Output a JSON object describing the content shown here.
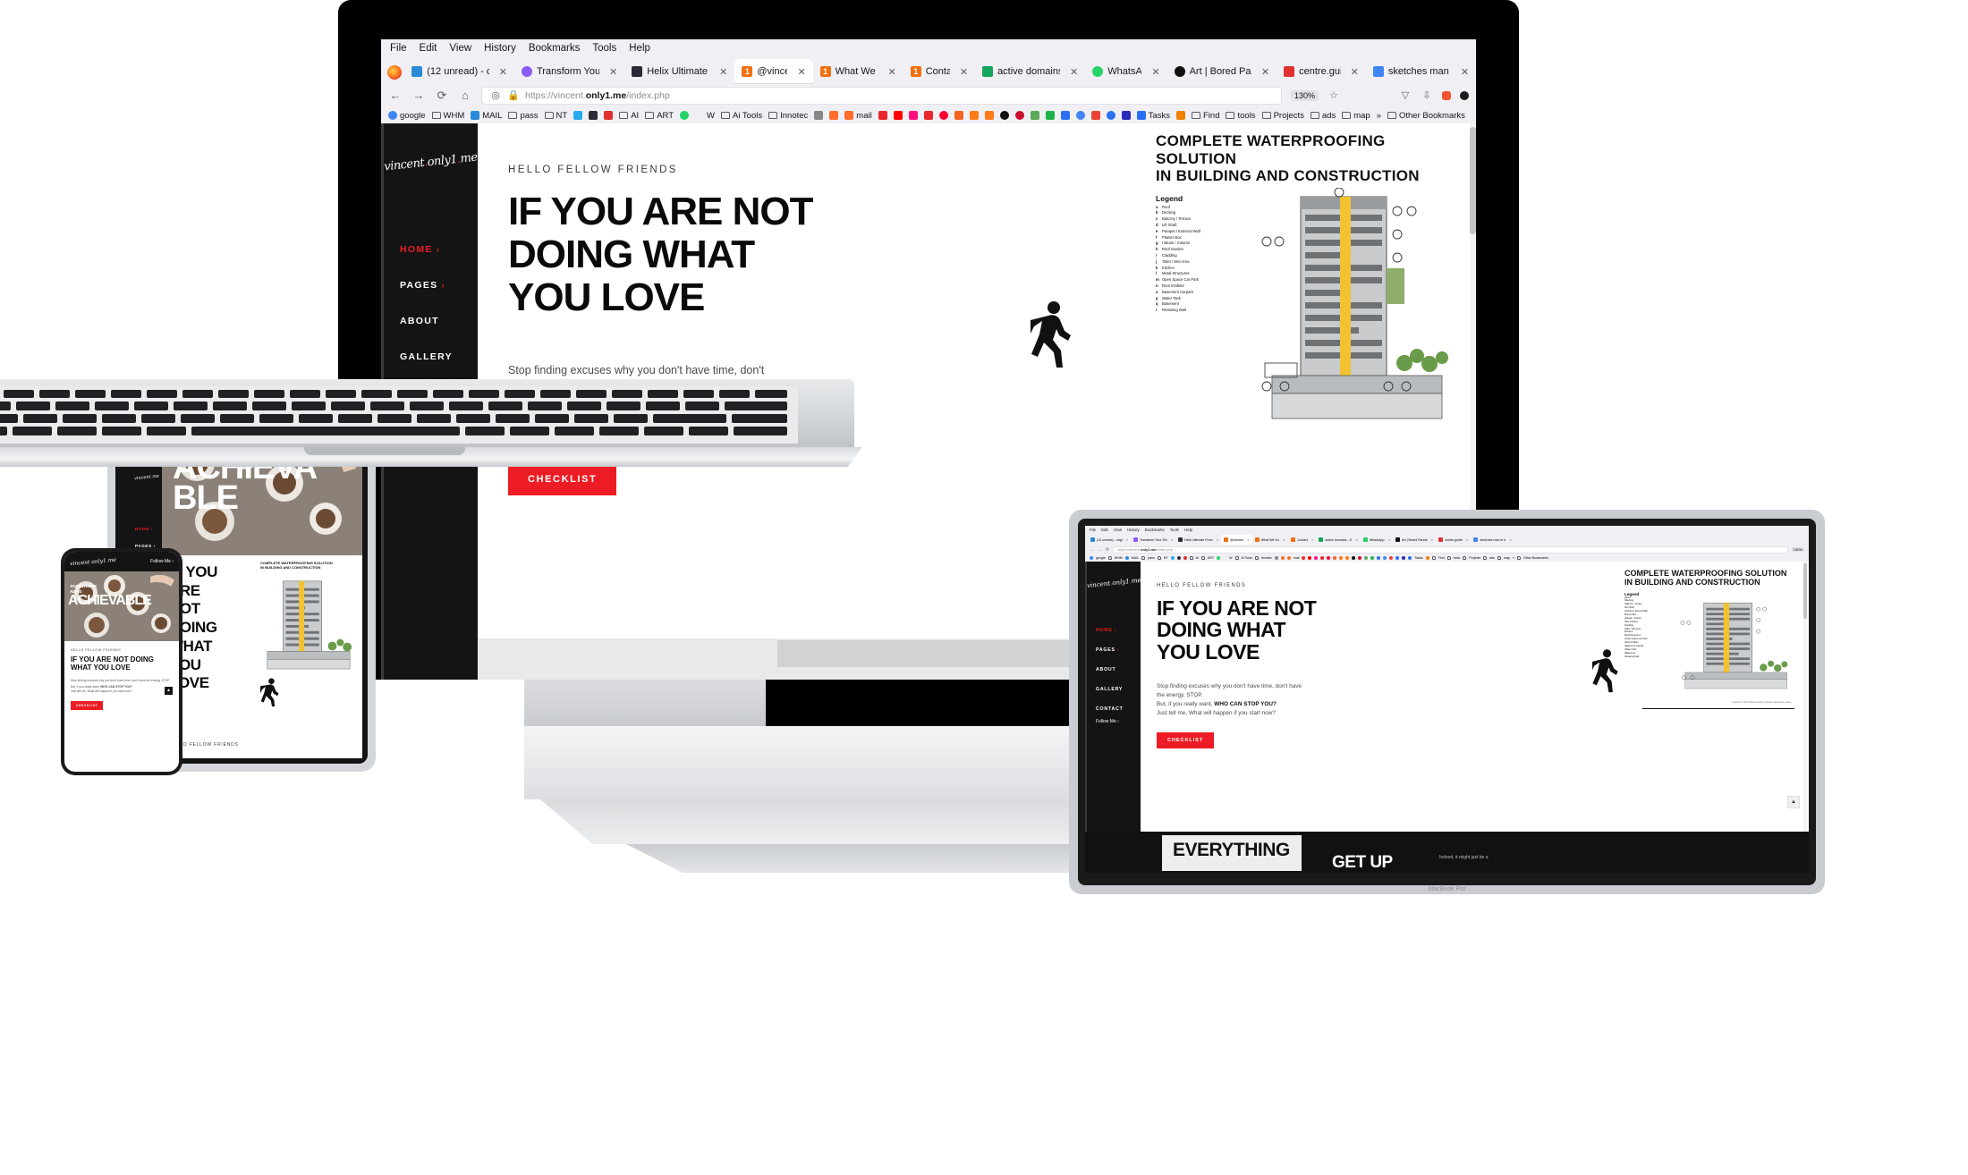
{
  "browser": {
    "menu": [
      "File",
      "Edit",
      "View",
      "History",
      "Bookmarks",
      "Tools",
      "Help"
    ],
    "tabs": [
      {
        "label": "(12 unread) - origi",
        "icon": "mail-icon",
        "active": false
      },
      {
        "label": "Transform Your Ski",
        "icon": "purple-circle-icon",
        "active": false
      },
      {
        "label": "Helix Ultimate Fram",
        "icon": "joomla-icon",
        "active": false
      },
      {
        "label": "@vincent",
        "icon": "orange-one-icon",
        "active": true
      },
      {
        "label": "What We Do",
        "icon": "orange-one-icon",
        "active": false
      },
      {
        "label": "Contact",
        "icon": "orange-one-icon",
        "active": false
      },
      {
        "label": "active domains - G",
        "icon": "sheets-icon",
        "active": false
      },
      {
        "label": "WhatsApp",
        "icon": "whatsapp-icon",
        "active": false
      },
      {
        "label": "Art | Bored Panda",
        "icon": "boredpanda-icon",
        "active": false
      },
      {
        "label": "centre.guide",
        "icon": "red-square-icon",
        "active": false
      },
      {
        "label": "sketches man in b",
        "icon": "google-icon",
        "active": false
      }
    ],
    "url_prefix": "https://vincent.",
    "url_bold": "only1.me",
    "url_suffix": "/index.php",
    "zoom": "130%",
    "bookmarks": [
      {
        "label": "google",
        "icon": "google-icon"
      },
      {
        "label": "WHM",
        "icon": "folder-icon"
      },
      {
        "label": "MAIL",
        "icon": "mail-icon"
      },
      {
        "label": "pass",
        "icon": "folder-icon"
      },
      {
        "label": "NT",
        "icon": "folder-icon"
      },
      {
        "label": "",
        "icon": "telegram-icon"
      },
      {
        "label": "",
        "icon": "joomla-icon"
      },
      {
        "label": "",
        "icon": "redblock-icon"
      },
      {
        "label": "AI",
        "icon": "folder-icon"
      },
      {
        "label": "ART",
        "icon": "folder-icon"
      },
      {
        "label": "",
        "icon": "whatsapp-icon"
      },
      {
        "label": "W",
        "icon": "w-icon"
      },
      {
        "label": "Ai Tools",
        "icon": "folder-icon"
      },
      {
        "label": "Innotec",
        "icon": "folder-icon"
      },
      {
        "label": "",
        "icon": "compass-icon"
      },
      {
        "label": "",
        "icon": "cpanel-icon"
      },
      {
        "label": "mail",
        "icon": "cpanel-icon"
      },
      {
        "label": "",
        "icon": "adobe-icon"
      },
      {
        "label": "",
        "icon": "youtube-icon"
      },
      {
        "label": "",
        "icon": "download-icon"
      },
      {
        "label": "",
        "icon": "heart-icon"
      },
      {
        "label": "",
        "icon": "opera-icon"
      },
      {
        "label": "",
        "icon": "pin-icon"
      },
      {
        "label": "",
        "icon": "flame-icon"
      },
      {
        "label": "",
        "icon": "wave-icon"
      },
      {
        "label": "",
        "icon": "yin-icon"
      },
      {
        "label": "",
        "icon": "edge-icon"
      },
      {
        "label": "",
        "icon": "evernote-icon"
      },
      {
        "label": "",
        "icon": "arrow-icon"
      },
      {
        "label": "",
        "icon": "blue-icon"
      },
      {
        "label": "",
        "icon": "google-icon"
      },
      {
        "label": "",
        "icon": "gmail-icon"
      },
      {
        "label": "",
        "icon": "at-icon"
      },
      {
        "label": "",
        "icon": "q-icon"
      },
      {
        "label": "Tasks",
        "icon": "tasks-icon"
      },
      {
        "label": "",
        "icon": "moon-icon"
      },
      {
        "label": "Find",
        "icon": "folder-icon"
      },
      {
        "label": "tools",
        "icon": "folder-icon"
      },
      {
        "label": "Projects",
        "icon": "folder-icon"
      },
      {
        "label": "ads",
        "icon": "folder-icon"
      },
      {
        "label": "map",
        "icon": "folder-icon"
      }
    ],
    "overflow_label": "»",
    "other_bookmarks": "Other Bookmarks"
  },
  "site": {
    "logo": "vincent.only1.me",
    "nav": [
      {
        "label": "HOME",
        "chevron": "›",
        "active": true
      },
      {
        "label": "PAGES",
        "chevron": "›",
        "active": false
      },
      {
        "label": "ABOUT",
        "chevron": "",
        "active": false
      },
      {
        "label": "GALLERY",
        "chevron": "",
        "active": false
      },
      {
        "label": "CONTACT",
        "chevron": "",
        "active": false
      }
    ],
    "follow_me": "Follow Me ›",
    "eyebrow": "HELLO FELLOW FRIENDS",
    "headline": [
      "IF YOU ARE NOT",
      "DOING WHAT",
      "YOU LOVE"
    ],
    "body_line1": "Stop finding excuses why you don't have time, don't have",
    "body_line2": "the energy. STOP.",
    "body_line3_pre": "But, if you really want, ",
    "body_line3_bold": "WHO CAN STOP YOU?",
    "body_line4": "Just tell me, What will happen if you start now?",
    "cta": "CHECKLIST",
    "accent": "#ed1c24",
    "dark": "#141414",
    "caption": "created in 2015 Waterproofing products  application areas"
  },
  "infographic": {
    "title_line1": "COMPLETE WATERPROOFING SOLUTION",
    "title_line2": "IN BUILDING AND CONSTRUCTION",
    "legend_title": "Legend",
    "legend": [
      {
        "key": "a",
        "label": "Roof"
      },
      {
        "key": "b",
        "label": "Decking"
      },
      {
        "key": "c",
        "label": "Balcony / Terrace"
      },
      {
        "key": "d",
        "label": "Lift Shaft"
      },
      {
        "key": "e",
        "label": "Parapet / External Wall"
      },
      {
        "key": "f",
        "label": "Planter Box"
      },
      {
        "key": "g",
        "label": "I Beam / Column"
      },
      {
        "key": "h",
        "label": "Roof Garden"
      },
      {
        "key": "i",
        "label": "Cladding"
      },
      {
        "key": "j",
        "label": "Toilet / Wet Area"
      },
      {
        "key": "k",
        "label": "Kitchen"
      },
      {
        "key": "l",
        "label": "Metal Structures"
      },
      {
        "key": "m",
        "label": "Open Space Car Park"
      },
      {
        "key": "n",
        "label": "Root Inhibitor"
      },
      {
        "key": "o",
        "label": "Basement Carpark"
      },
      {
        "key": "p",
        "label": "Water Tank"
      },
      {
        "key": "q",
        "label": "Basement"
      },
      {
        "key": "r",
        "label": "Retaining Wall"
      }
    ]
  },
  "tablet": {
    "overlay_small": "YOUR DREAMS ARE",
    "overlay_small2": "ALWAYS",
    "overlay_big1": "ACHIEVA",
    "overlay_big2": "BLE",
    "headline": [
      "IF YOU",
      "ARE NOT",
      "DOING",
      "WHAT",
      "YOU",
      "LOVE"
    ]
  },
  "phone": {
    "follow_me": "Follow Me ›",
    "overlay1": "YOUR DREAMS ARE",
    "overlay2": "ALWAYS",
    "overlay_big": "ACHIEVABLE",
    "eyebrow": "HELLO FELLOW FRIENDS",
    "headline": "IF YOU ARE NOT DOING WHAT YOU LOVE",
    "body": "Stop finding excuses why you don't have time, don't have the energy. STOP.",
    "body2_pre": "But, if you really want, ",
    "body2_bold": "WHO CAN STOP YOU?",
    "body3": "Just tell me, What will happen if you start now?",
    "cta": "CHECKLIST"
  },
  "laptop_scroll": {
    "band_word": "EVERYTHING",
    "band_word2": "GET UP",
    "tail": "Indeed, it might just be a"
  },
  "laptop_chin": "MacBook Pro"
}
